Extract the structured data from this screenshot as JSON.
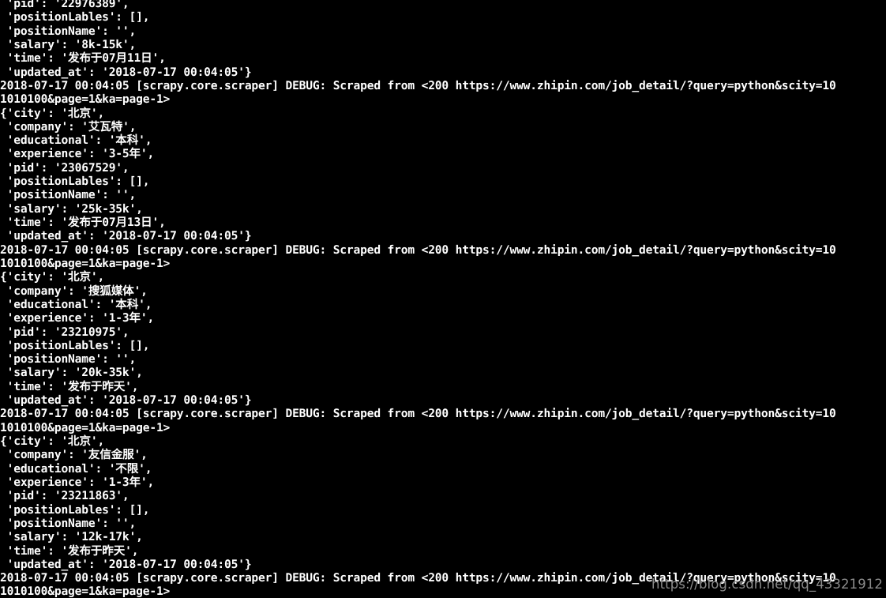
{
  "terminal": {
    "background_color": "#000000",
    "foreground_color": "#ffffff",
    "watermark": "https://blog.csdn.net/qq_43321912",
    "watermark_color": "#8c8c8c",
    "log": {
      "timestamp": "2018-07-17 00:04:05",
      "logger": "scrapy.core.scraper",
      "level": "DEBUG",
      "message": "Scraped from",
      "status": "<200",
      "url": "https://www.zhipin.com/job_detail/?query=python&scity=101010100&page=1&ka=page-1>"
    },
    "lines": [
      " 'pid': '22976389',",
      " 'positionLables': [],",
      " 'positionName': '',",
      " 'salary': '8k-15k',",
      " 'time': '发布于07月11日',",
      " 'updated_at': '2018-07-17 00:04:05'}",
      "2018-07-17 00:04:05 [scrapy.core.scraper] DEBUG: Scraped from <200 https://www.zhipin.com/job_detail/?query=python&scity=10",
      "1010100&page=1&ka=page-1>",
      "{'city': '北京',",
      " 'company': '艾瓦特',",
      " 'educational': '本科',",
      " 'experience': '3-5年',",
      " 'pid': '23067529',",
      " 'positionLables': [],",
      " 'positionName': '',",
      " 'salary': '25k-35k',",
      " 'time': '发布于07月13日',",
      " 'updated_at': '2018-07-17 00:04:05'}",
      "2018-07-17 00:04:05 [scrapy.core.scraper] DEBUG: Scraped from <200 https://www.zhipin.com/job_detail/?query=python&scity=10",
      "1010100&page=1&ka=page-1>",
      "{'city': '北京',",
      " 'company': '搜狐媒体',",
      " 'educational': '本科',",
      " 'experience': '1-3年',",
      " 'pid': '23210975',",
      " 'positionLables': [],",
      " 'positionName': '',",
      " 'salary': '20k-35k',",
      " 'time': '发布于昨天',",
      " 'updated_at': '2018-07-17 00:04:05'}",
      "2018-07-17 00:04:05 [scrapy.core.scraper] DEBUG: Scraped from <200 https://www.zhipin.com/job_detail/?query=python&scity=10",
      "1010100&page=1&ka=page-1>",
      "{'city': '北京',",
      " 'company': '友信金服',",
      " 'educational': '不限',",
      " 'experience': '1-3年',",
      " 'pid': '23211863',",
      " 'positionLables': [],",
      " 'positionName': '',",
      " 'salary': '12k-17k',",
      " 'time': '发布于昨天',",
      " 'updated_at': '2018-07-17 00:04:05'}",
      "2018-07-17 00:04:05 [scrapy.core.scraper] DEBUG: Scraped from <200 https://www.zhipin.com/job_detail/?query=python&scity=10",
      "1010100&page=1&ka=page-1>"
    ],
    "records": [
      {
        "city": "北京",
        "company": "艾瓦特",
        "educational": "本科",
        "experience": "3-5年",
        "pid": "23067529",
        "positionLables": "[]",
        "positionName": "''",
        "salary": "25k-35k",
        "time": "发布于07月13日",
        "updated_at": "2018-07-17 00:04:05"
      },
      {
        "city": "北京",
        "company": "搜狐媒体",
        "educational": "本科",
        "experience": "1-3年",
        "pid": "23210975",
        "positionLables": "[]",
        "positionName": "''",
        "salary": "20k-35k",
        "time": "发布于昨天",
        "updated_at": "2018-07-17 00:04:05"
      },
      {
        "city": "北京",
        "company": "友信金服",
        "educational": "不限",
        "experience": "1-3年",
        "pid": "23211863",
        "positionLables": "[]",
        "positionName": "''",
        "salary": "12k-17k",
        "time": "发布于昨天",
        "updated_at": "2018-07-17 00:04:05"
      }
    ]
  }
}
